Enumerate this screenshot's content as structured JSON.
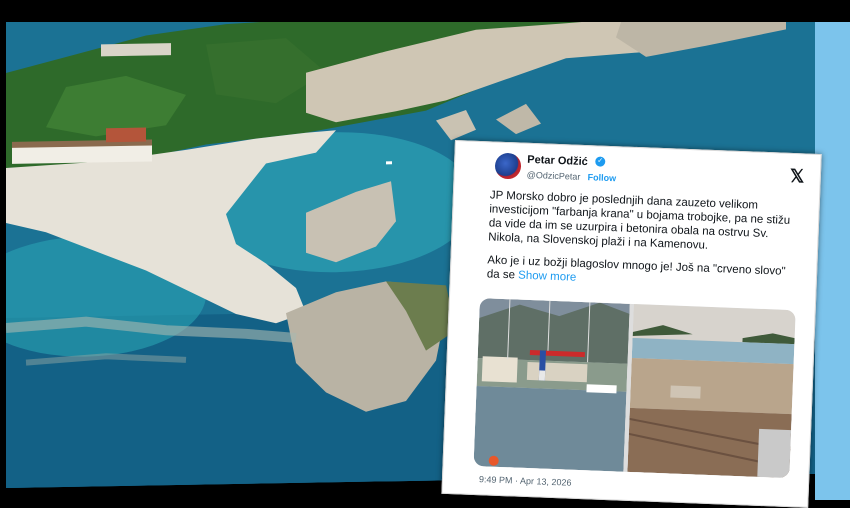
{
  "tweet": {
    "author_name": "Petar Odžić",
    "handle": "@OdzicPetar",
    "follow_label": "Follow",
    "verified_mark": "✓",
    "x_logo": "𝕏",
    "paragraph1": "JP Morsko dobro je poslednjih dana zauzeto velikom investicijom \"farbanja krana\" u bojama trobojke, pa ne stižu da vide da im se uzurpira i betonira obala na ostrvu Sv. Nikola, na Slovenskoj plaži i na Kamenovu.",
    "paragraph2_prefix": "Ako je i uz božji blagoslov mnogo je! Još na \"crveno slovo\" da se ",
    "show_more_label": "Show more",
    "timestamp": "9:49 PM · Apr 13, 2026",
    "media": [
      {
        "icon": "harbor-crane-photo"
      },
      {
        "icon": "beach-construction-photo"
      }
    ]
  },
  "colors": {
    "link_blue": "#1d9bf0",
    "sea_turquoise": "#1f8fa8",
    "frame_right_blue": "#7cc4ec"
  }
}
